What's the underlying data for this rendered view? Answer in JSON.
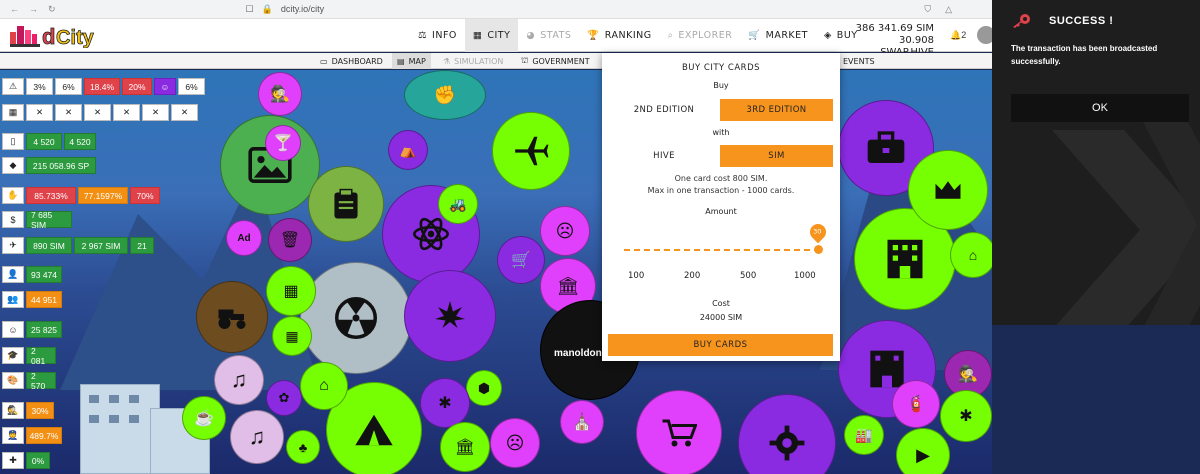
{
  "browser": {
    "url": "dcity.io/city"
  },
  "header": {
    "nav": [
      {
        "label": "INFO",
        "icon": "scale-icon"
      },
      {
        "label": "CITY",
        "icon": "city-icon"
      },
      {
        "label": "STATS",
        "icon": "pie-icon"
      },
      {
        "label": "RANKING",
        "icon": "trophy-icon"
      },
      {
        "label": "EXPLORER",
        "icon": "search-icon"
      },
      {
        "label": "MARKET",
        "icon": "cart-icon"
      },
      {
        "label": "BUY",
        "icon": "layers-icon"
      }
    ],
    "balance_sim": "386 341.69 SIM",
    "balance_hive": "30.908 SWAP.HIVE",
    "notifications": "2"
  },
  "subnav": [
    {
      "label": "DASHBOARD"
    },
    {
      "label": "MAP"
    },
    {
      "label": "SIMULATION"
    },
    {
      "label": "GOVERNMENT"
    },
    {
      "label": "EVENTS"
    }
  ],
  "stats": {
    "row1": [
      "3%",
      "6%",
      "18.4%",
      "20%",
      "6%"
    ],
    "row2": [
      "✕",
      "✕",
      "✕",
      "✕",
      "✕",
      "✕"
    ],
    "pop": [
      "4 520",
      "4 520"
    ],
    "sp": "215 058.96 SP",
    "income": [
      "85.733%",
      "77.1597%",
      "70%"
    ],
    "sim": "7 685 SIM",
    "transport": [
      "890 SIM",
      "2 967 SIM",
      "21"
    ],
    "people": "93 474",
    "workers": "44 951",
    "v1": "25 825",
    "v2": "2 081",
    "v3": "2 570",
    "v4": "30%",
    "v5": "489.7%",
    "v6": "0%"
  },
  "map": {
    "city_label": "manoldon"
  },
  "buy_panel": {
    "title": "BUY CITY CARDS",
    "buy_label": "Buy",
    "edition_options": [
      "2ND EDITION",
      "3RD EDITION"
    ],
    "with_label": "with",
    "currency_options": [
      "HIVE",
      "SIM"
    ],
    "info_line1": "One card cost 800 SIM.",
    "info_line2": "Max in one transaction - 1000 cards.",
    "amount_label": "Amount",
    "amount_value": "30",
    "amount_fraction": 0.03,
    "ticks": [
      "100",
      "200",
      "500",
      "1000"
    ],
    "cost_label": "Cost",
    "cost_value": "24000 SIM",
    "button": "BUY CARDS"
  },
  "notification": {
    "title": "SUCCESS !",
    "message": "The transaction has been broadcasted successfully.",
    "ok": "OK"
  },
  "colors": {
    "accent": "#f7941d",
    "green": "#2c9a3e",
    "red": "#e0424a"
  }
}
